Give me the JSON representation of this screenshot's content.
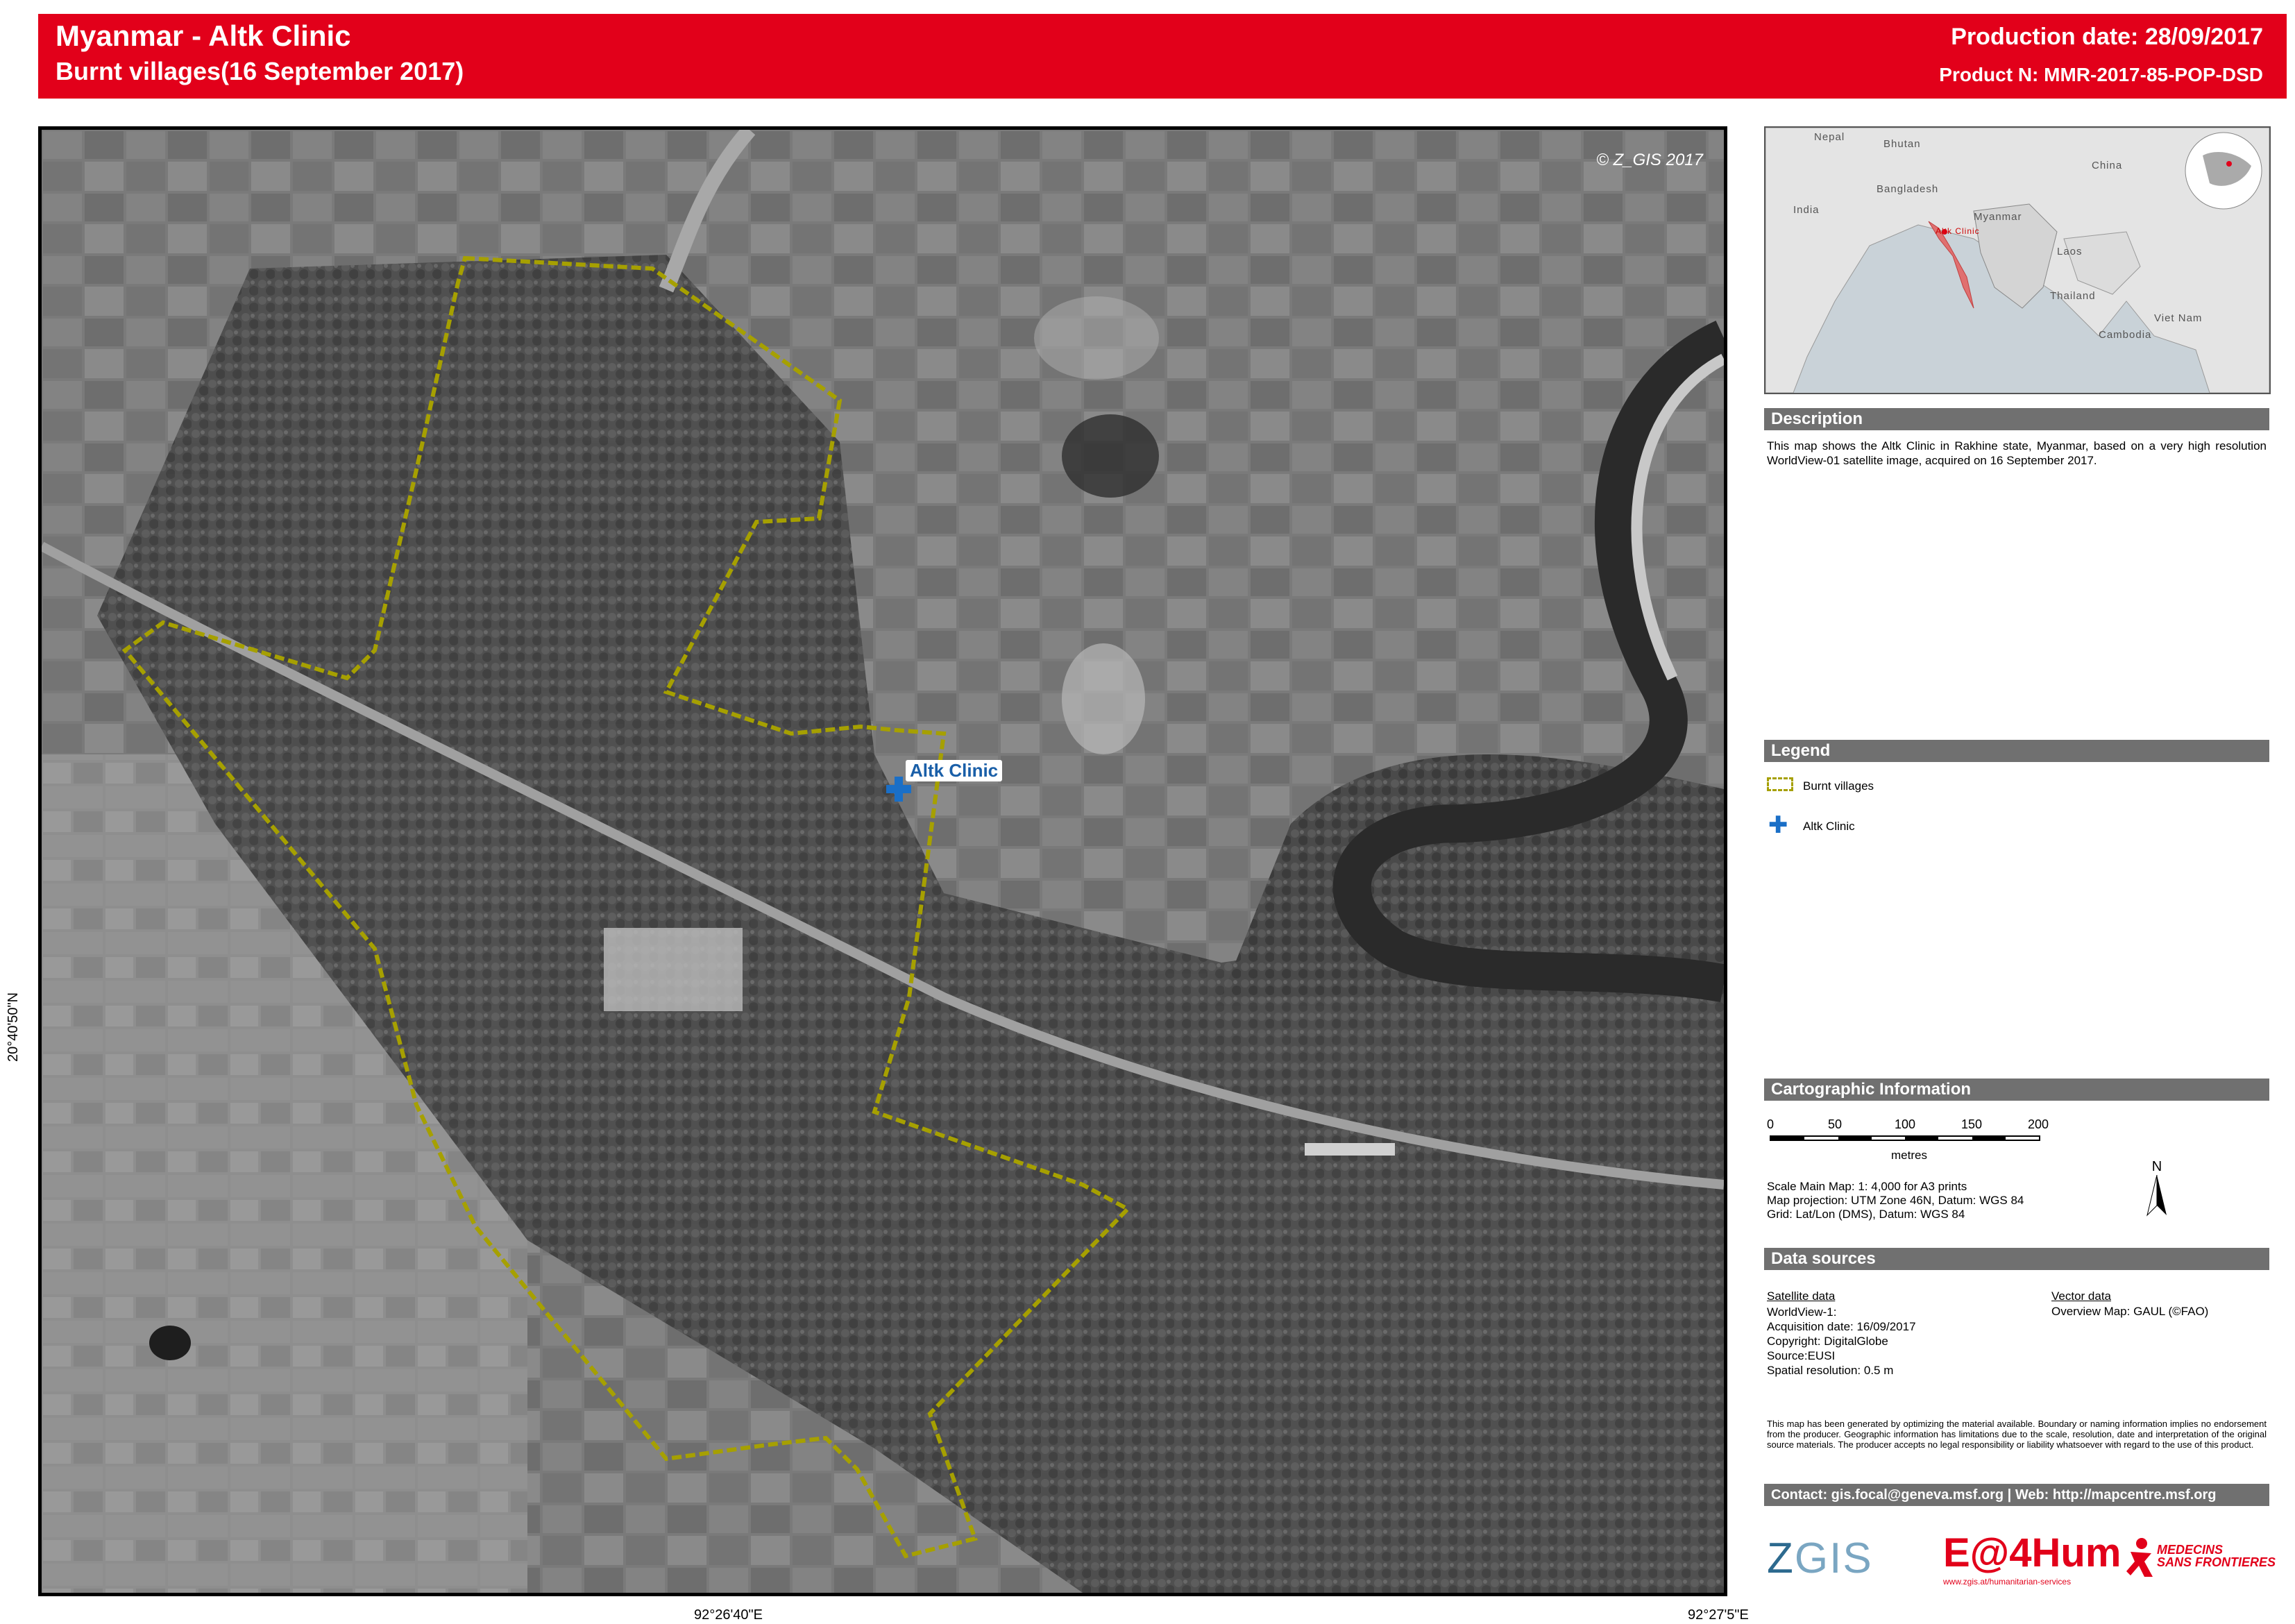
{
  "header": {
    "title": "Myanmar - Altk Clinic",
    "subtitle": "Burnt villages(16 September 2017)",
    "production_date": "Production date: 28/09/2017",
    "product_number": "Product N: MMR-2017-85-POP-DSD"
  },
  "main_map": {
    "copyright": "© Z_GIS 2017",
    "clinic_label": "Altk  Clinic",
    "coord_left": "20°40'50\"N",
    "coord_bottom_1": "92°26'40\"E",
    "coord_bottom_2": "92°27'5\"E",
    "burnt_area_color": "#a6a000",
    "clinic_color": "#1a6fc7",
    "features": [
      {
        "kind": "burnt-village-area",
        "label": "Burnt villages"
      },
      {
        "kind": "clinic",
        "label": "Altk Clinic"
      }
    ]
  },
  "overview": {
    "labels": [
      "Nepal",
      "Bhutan",
      "China",
      "Bangladesh",
      "India",
      "Myanmar",
      "Altk Clinic",
      "Laos",
      "Thailand",
      "Viet Nam",
      "Cambodia"
    ],
    "highlight_color": "#e07070"
  },
  "description": {
    "heading": "Description",
    "text": "This map shows the Altk Clinic in Rakhine state, Myanmar, based on a very high resolution WorldView-01 satellite image, acquired on 16 September 2017."
  },
  "legend": {
    "heading": "Legend",
    "items": [
      {
        "label": "Burnt villages",
        "icon": "dashed-outline-icon"
      },
      {
        "label": "Altk Clinic",
        "icon": "medical-cross-icon"
      }
    ]
  },
  "cartographic": {
    "heading": "Cartographic Information",
    "scale_ticks": [
      "0",
      "50",
      "100",
      "150",
      "200"
    ],
    "scale_units": "metres",
    "scale_line": "Scale Main Map: 1: 4,000 for A3 prints",
    "projection_line": "Map projection: UTM Zone 46N, Datum: WGS 84",
    "grid_line": "Grid: Lat/Lon (DMS), Datum: WGS 84",
    "north_label": "N"
  },
  "data_sources": {
    "heading": "Data sources",
    "satellite_heading": "Satellite data",
    "satellite_lines": [
      "WorldView-1:",
      "Acquisition date: 16/09/2017",
      "Copyright: DigitalGlobe",
      "Source:EUSI",
      "Spatial resolution: 0.5 m"
    ],
    "vector_heading": "Vector data",
    "vector_line": "Overview Map: GAUL (©FAO)"
  },
  "disclaimer": "This map has been generated by optimizing the material available. Boundary or naming information implies no endorsement from the producer. Geographic information has limitations due to the scale, resolution, date and interpretation of the original source materials. The producer accepts no legal responsibility or liability whatsoever with regard to the use of this product.",
  "contact": "Contact: gis.focal@geneva.msf.org | Web: http://mapcentre.msf.org",
  "logos": {
    "zgis_a": "Z",
    "zgis_b": "GIS",
    "eo4hum": "E@4Hum",
    "eo4hum_sub": "www.zgis.at/humanitarian-services",
    "msf_line1": "MEDECINS",
    "msf_line2": "SANS FRONTIERES"
  }
}
